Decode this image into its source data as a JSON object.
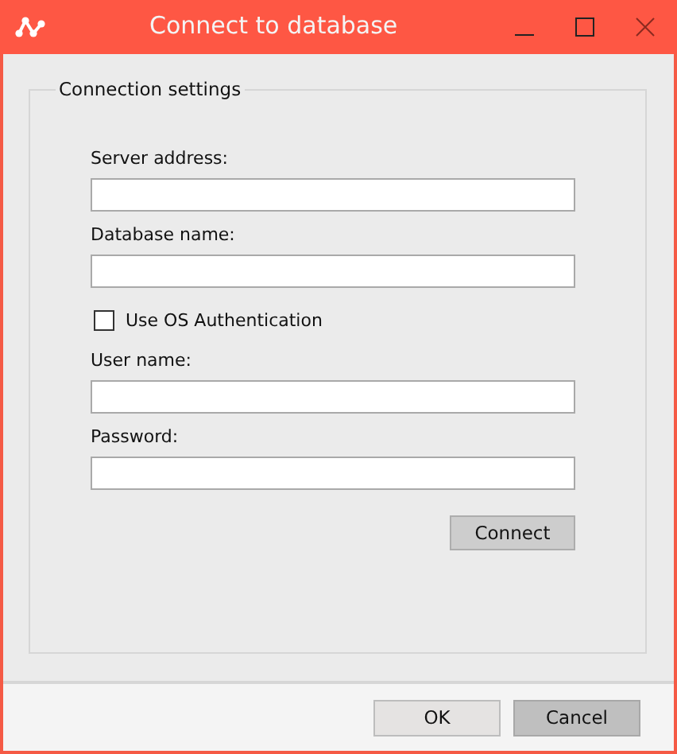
{
  "window": {
    "title": "Connect to database"
  },
  "group": {
    "title": "Connection settings",
    "fields": [
      {
        "kind": "text",
        "label": "Server address:"
      },
      {
        "kind": "text",
        "label": "Database name:"
      },
      {
        "kind": "checkbox",
        "label": "Use OS Authentication",
        "checked": false
      },
      {
        "kind": "text",
        "label": "User name:"
      },
      {
        "kind": "password",
        "label": "Password:"
      }
    ],
    "action": "Connect"
  },
  "buttons": [
    "OK",
    "Cancel"
  ]
}
